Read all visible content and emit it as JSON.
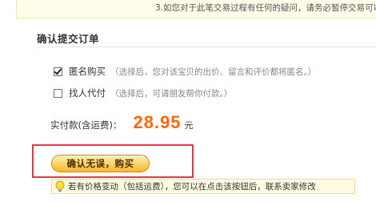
{
  "notice": {
    "text": "3.如您对于此笔交易过程有任何的疑问，请务必暂停交易可以找"
  },
  "section": {
    "title": "确认提交订单"
  },
  "options": {
    "anonymous": {
      "checked": true,
      "label": "匿名购买",
      "note": "（选择后，您对该宝贝的出价、留言和评价都将匿名。）"
    },
    "proxy_pay": {
      "checked": false,
      "label": "找人代付",
      "note": "（选择后，可请朋友帮你付款。）"
    }
  },
  "payment": {
    "label": "实付款(含运费)：",
    "amount": "28.95",
    "unit": "元"
  },
  "confirm": {
    "button_label": "确认无误，购买"
  },
  "tip": {
    "icon": "lightbulb-icon",
    "text": "若有价格变动（包括运费），您可以在点击该按钮后，联系卖家修改"
  },
  "colors": {
    "amount": "#ff6600",
    "highlight_border": "#e8373c",
    "button_gradient_top": "#fff0b3",
    "button_gradient_bottom": "#f7b733",
    "tip_background": "#fffbe0"
  }
}
